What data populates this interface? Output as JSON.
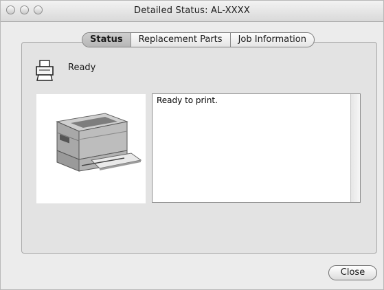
{
  "window": {
    "title": "Detailed Status: AL-XXXX"
  },
  "tabs": [
    {
      "label": "Status",
      "active": true
    },
    {
      "label": "Replacement Parts",
      "active": false
    },
    {
      "label": "Job Information",
      "active": false
    }
  ],
  "status": {
    "icon": "printer-icon",
    "text": "Ready"
  },
  "message": {
    "text": "Ready to print."
  },
  "buttons": {
    "close_label": "Close"
  }
}
